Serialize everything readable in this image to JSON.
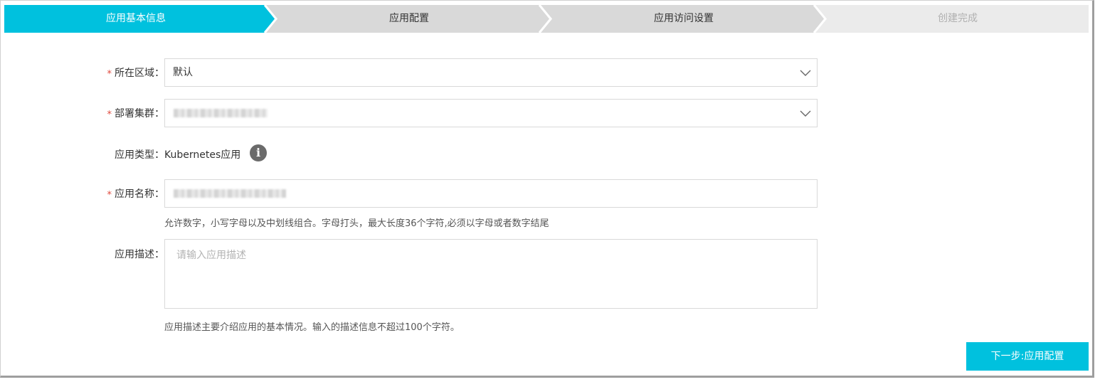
{
  "steps": [
    {
      "label": "应用基本信息",
      "state": "active"
    },
    {
      "label": "应用配置",
      "state": "pending"
    },
    {
      "label": "应用访问设置",
      "state": "pending"
    },
    {
      "label": "创建完成",
      "state": "disabled"
    }
  ],
  "form": {
    "region": {
      "label": "所在区域：",
      "required": true,
      "value": "默认"
    },
    "cluster": {
      "label": "部署集群：",
      "required": true,
      "value": ""
    },
    "app_type": {
      "label": "应用类型：",
      "value": "Kubernetes应用",
      "icon": "info-icon"
    },
    "app_name": {
      "label": "应用名称：",
      "required": true,
      "value": "",
      "hint": "允许数字，小写字母以及中划线组合。字母打头，最大长度36个字符,必须以字母或者数字结尾"
    },
    "app_desc": {
      "label": "应用描述：",
      "placeholder": "请输入应用描述",
      "hint": "应用描述主要介绍应用的基本情况。输入的描述信息不超过100个字符。"
    },
    "required_mark": "*"
  },
  "actions": {
    "next_label": "下一步:应用配置"
  },
  "colors": {
    "accent": "#00c1de",
    "step_pending": "#d9d9d9",
    "step_disabled": "#ebebeb",
    "required": "#e0493d"
  }
}
